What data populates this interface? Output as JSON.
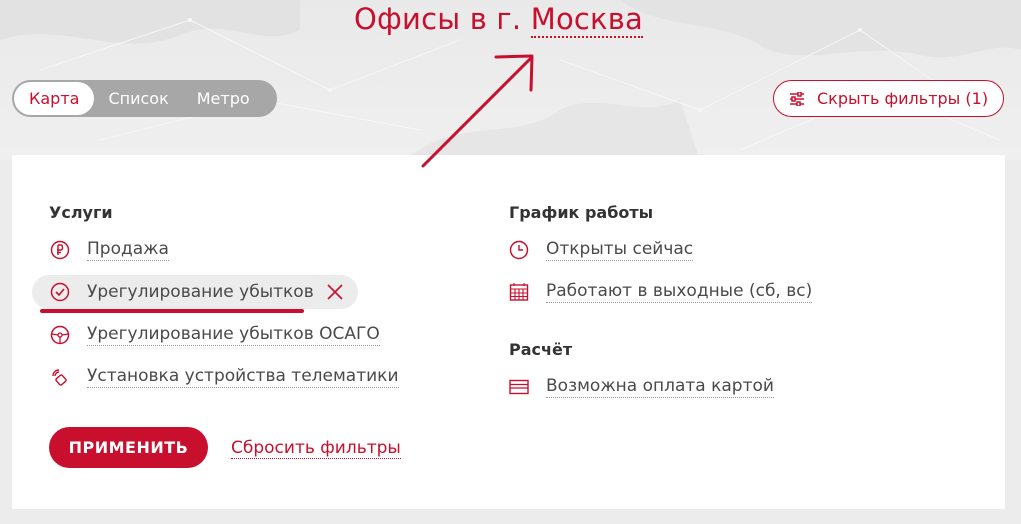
{
  "header": {
    "title_prefix": "Офисы в г.",
    "city": "Москва"
  },
  "view_tabs": [
    {
      "label": "Карта",
      "active": true
    },
    {
      "label": "Список",
      "active": false
    },
    {
      "label": "Метро",
      "active": false
    }
  ],
  "filter_toggle": {
    "label": "Скрыть фильтры (1)",
    "icon": "sliders-icon"
  },
  "filters": {
    "services": {
      "title": "Услуги",
      "options": [
        {
          "label": "Продажа",
          "icon": "ruble-icon",
          "selected": false
        },
        {
          "label": "Урегулирование убытков",
          "icon": "check-circle-icon",
          "selected": true
        },
        {
          "label": "Урегулирование убытков ОСАГО",
          "icon": "steering-wheel-icon",
          "selected": false
        },
        {
          "label": "Установка устройства телематики",
          "icon": "telematics-icon",
          "selected": false
        }
      ]
    },
    "schedule": {
      "title": "График работы",
      "options": [
        {
          "label": "Открыты сейчас",
          "icon": "clock-icon",
          "selected": false
        },
        {
          "label": "Работают в выходные (сб, вс)",
          "icon": "calendar-icon",
          "selected": false
        }
      ]
    },
    "payment": {
      "title": "Расчёт",
      "options": [
        {
          "label": "Возможна оплата картой",
          "icon": "card-icon",
          "selected": false
        }
      ]
    }
  },
  "actions": {
    "apply_label": "ПРИМЕНИТЬ",
    "reset_label": "Сбросить фильтры"
  },
  "colors": {
    "accent": "#c8102e",
    "toggle_bg": "#a7a7a7",
    "page_bg": "#ececec",
    "panel_bg": "#ffffff"
  }
}
